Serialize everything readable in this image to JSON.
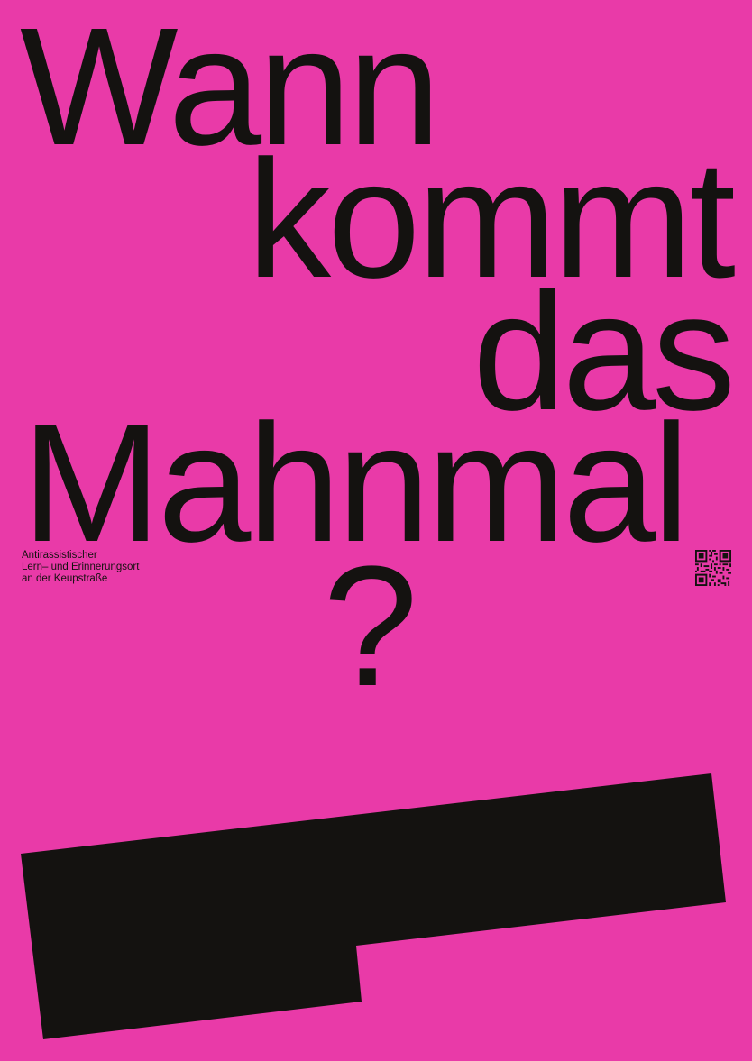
{
  "poster": {
    "headline": {
      "line1": "Wann",
      "line2": "kommt",
      "line3": "das",
      "line4": "Mahnmal",
      "question_mark": "?"
    },
    "subtitle": {
      "line1": "Antirassistischer",
      "line2": "Lern– und Erinnerungsort",
      "line3": "an der Keupstraße"
    },
    "colors": {
      "background": "#e93aa8",
      "ink": "#141210"
    },
    "icons": {
      "qr": "qr-code-icon"
    }
  }
}
